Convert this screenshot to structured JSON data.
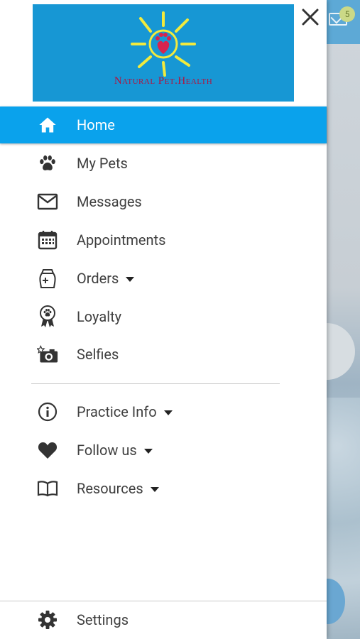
{
  "logo": {
    "text": "Natural Pet.Health",
    "colors": {
      "background": "#1797d4",
      "sun": "#f2ea3d",
      "paw": "#d8234f"
    }
  },
  "close": {
    "icon": "close-icon"
  },
  "menu": {
    "items": [
      {
        "label": "Home",
        "icon": "home-icon",
        "active": true
      },
      {
        "label": "My Pets",
        "icon": "paw-icon"
      },
      {
        "label": "Messages",
        "icon": "mail-icon"
      },
      {
        "label": "Appointments",
        "icon": "calendar-icon"
      },
      {
        "label": "Orders",
        "icon": "food-bag-icon",
        "expandable": true
      },
      {
        "label": "Loyalty",
        "icon": "award-ribbon-icon"
      },
      {
        "label": "Selfies",
        "icon": "camera-star-icon"
      }
    ],
    "secondary": [
      {
        "label": "Practice Info",
        "icon": "info-icon",
        "expandable": true
      },
      {
        "label": "Follow us",
        "icon": "heart-icon",
        "expandable": true
      },
      {
        "label": "Resources",
        "icon": "book-icon",
        "expandable": true
      }
    ],
    "footer": {
      "label": "Settings",
      "icon": "gear-icon"
    }
  },
  "background_app": {
    "message_badge": "5",
    "accent": "#5da9d6"
  },
  "colors": {
    "active_bg": "#0aa2ec",
    "text": "#3f3f3f",
    "icon": "#333333"
  }
}
